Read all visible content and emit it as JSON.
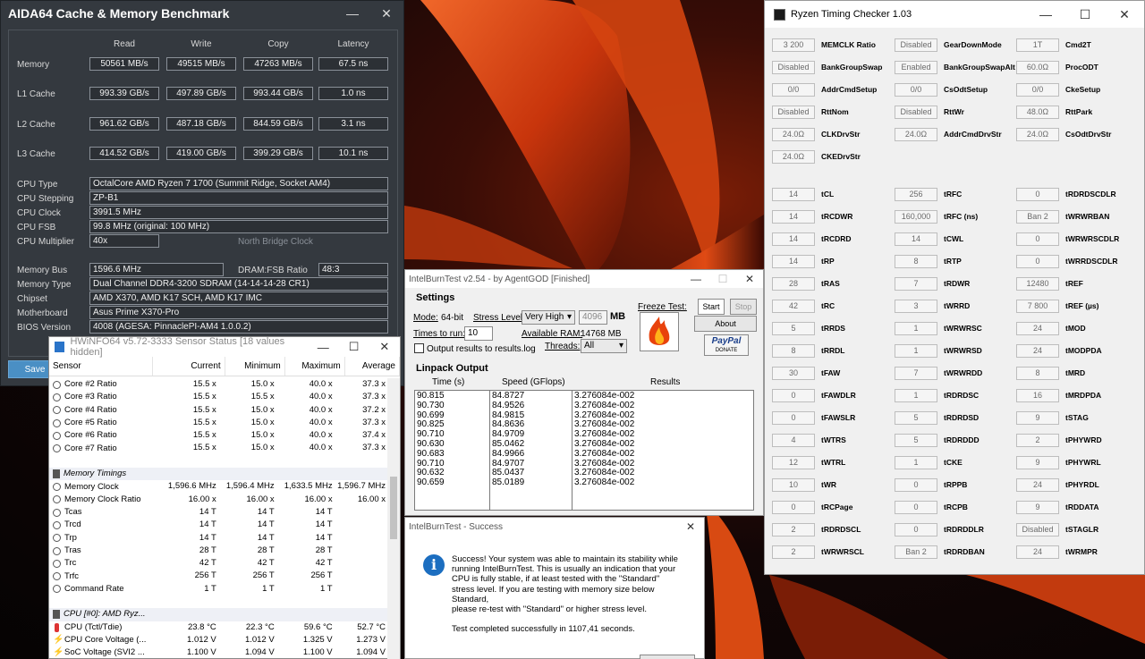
{
  "aida": {
    "title": "AIDA64 Cache & Memory Benchmark",
    "headers": [
      "Read",
      "Write",
      "Copy",
      "Latency"
    ],
    "rows": [
      {
        "label": "Memory",
        "read": "50561 MB/s",
        "write": "49515 MB/s",
        "copy": "47263 MB/s",
        "latency": "67.5 ns"
      },
      {
        "label": "L1 Cache",
        "read": "993.39 GB/s",
        "write": "497.89 GB/s",
        "copy": "993.44 GB/s",
        "latency": "1.0 ns"
      },
      {
        "label": "L2 Cache",
        "read": "961.62 GB/s",
        "write": "487.18 GB/s",
        "copy": "844.59 GB/s",
        "latency": "3.1 ns"
      },
      {
        "label": "L3 Cache",
        "read": "414.52 GB/s",
        "write": "419.00 GB/s",
        "copy": "399.29 GB/s",
        "latency": "10.1 ns"
      }
    ],
    "cpu_type_label": "CPU Type",
    "cpu_type": "OctalCore AMD Ryzen 7 1700  (Summit Ridge, Socket AM4)",
    "cpu_stepping_label": "CPU Stepping",
    "cpu_stepping": "ZP-B1",
    "cpu_clock_label": "CPU Clock",
    "cpu_clock": "3991.5 MHz",
    "cpu_fsb_label": "CPU FSB",
    "cpu_fsb": "99.8 MHz  (original: 100 MHz)",
    "cpu_mult_label": "CPU Multiplier",
    "cpu_mult": "40x",
    "nb_clock_label": "North Bridge Clock",
    "mem_bus_label": "Memory Bus",
    "mem_bus": "1596.6 MHz",
    "dram_fsb_label": "DRAM:FSB Ratio",
    "dram_fsb": "48:3",
    "mem_type_label": "Memory Type",
    "mem_type": "Dual Channel DDR4-3200 SDRAM  (14-14-14-28 CR1)",
    "chipset_label": "Chipset",
    "chipset": "AMD X370, AMD K17 SCH, AMD K17 IMC",
    "mobo_label": "Motherboard",
    "mobo": "Asus Prime X370-Pro",
    "bios_label": "BIOS Version",
    "bios": "4008  (AGESA: PinnaclePI-AM4 1.0.0.2)",
    "save": "Save"
  },
  "hwinfo": {
    "title": "HWiNFO64 v5.72-3333 Sensor Status [18 values hidden]",
    "headers": [
      "Sensor",
      "Current",
      "Minimum",
      "Maximum",
      "Average"
    ],
    "rows": [
      {
        "kind": "c",
        "name": "Core #2 Ratio",
        "cur": "15.5 x",
        "min": "15.0 x",
        "max": "40.0 x",
        "avg": "37.3 x"
      },
      {
        "kind": "c",
        "name": "Core #3 Ratio",
        "cur": "15.5 x",
        "min": "15.5 x",
        "max": "40.0 x",
        "avg": "37.3 x"
      },
      {
        "kind": "c",
        "name": "Core #4 Ratio",
        "cur": "15.5 x",
        "min": "15.0 x",
        "max": "40.0 x",
        "avg": "37.2 x"
      },
      {
        "kind": "c",
        "name": "Core #5 Ratio",
        "cur": "15.5 x",
        "min": "15.0 x",
        "max": "40.0 x",
        "avg": "37.3 x"
      },
      {
        "kind": "c",
        "name": "Core #6 Ratio",
        "cur": "15.5 x",
        "min": "15.0 x",
        "max": "40.0 x",
        "avg": "37.4 x"
      },
      {
        "kind": "c",
        "name": "Core #7 Ratio",
        "cur": "15.5 x",
        "min": "15.0 x",
        "max": "40.0 x",
        "avg": "37.3 x"
      },
      {
        "kind": "blank",
        "name": "",
        "cur": "",
        "min": "",
        "max": "",
        "avg": ""
      },
      {
        "kind": "grp",
        "name": "Memory Timings",
        "cur": "",
        "min": "",
        "max": "",
        "avg": ""
      },
      {
        "kind": "c",
        "name": "Memory Clock",
        "cur": "1,596.6 MHz",
        "min": "1,596.4 MHz",
        "max": "1,633.5 MHz",
        "avg": "1,596.7 MHz"
      },
      {
        "kind": "c",
        "name": "Memory Clock Ratio",
        "cur": "16.00 x",
        "min": "16.00 x",
        "max": "16.00 x",
        "avg": "16.00 x"
      },
      {
        "kind": "c",
        "name": "Tcas",
        "cur": "14 T",
        "min": "14 T",
        "max": "14 T",
        "avg": ""
      },
      {
        "kind": "c",
        "name": "Trcd",
        "cur": "14 T",
        "min": "14 T",
        "max": "14 T",
        "avg": ""
      },
      {
        "kind": "c",
        "name": "Trp",
        "cur": "14 T",
        "min": "14 T",
        "max": "14 T",
        "avg": ""
      },
      {
        "kind": "c",
        "name": "Tras",
        "cur": "28 T",
        "min": "28 T",
        "max": "28 T",
        "avg": ""
      },
      {
        "kind": "c",
        "name": "Trc",
        "cur": "42 T",
        "min": "42 T",
        "max": "42 T",
        "avg": ""
      },
      {
        "kind": "c",
        "name": "Trfc",
        "cur": "256 T",
        "min": "256 T",
        "max": "256 T",
        "avg": ""
      },
      {
        "kind": "c",
        "name": "Command Rate",
        "cur": "1 T",
        "min": "1 T",
        "max": "1 T",
        "avg": ""
      },
      {
        "kind": "blank",
        "name": "",
        "cur": "",
        "min": "",
        "max": "",
        "avg": ""
      },
      {
        "kind": "grp",
        "name": "CPU [#0]: AMD Ryz...",
        "cur": "",
        "min": "",
        "max": "",
        "avg": ""
      },
      {
        "kind": "t",
        "name": "CPU (Tctl/Tdie)",
        "cur": "23.8 °C",
        "min": "22.3 °C",
        "max": "59.6 °C",
        "avg": "52.7 °C"
      },
      {
        "kind": "v",
        "name": "CPU Core Voltage (...",
        "cur": "1.012 V",
        "min": "1.012 V",
        "max": "1.325 V",
        "avg": "1.273 V"
      },
      {
        "kind": "v",
        "name": "SoC Voltage (SVI2 ...",
        "cur": "1.100 V",
        "min": "1.094 V",
        "max": "1.100 V",
        "avg": "1.094 V"
      }
    ]
  },
  "ibt": {
    "title": "IntelBurnTest v2.54 - by AgentGOD [Finished]",
    "settings": "Settings",
    "mode_label": "Mode:",
    "mode": "64-bit",
    "stress_label": "Stress Level:",
    "stress": "Very High",
    "mem": "4096",
    "mb": "MB",
    "times_label": "Times to run:",
    "times": "10",
    "avail_label": "Available RAM:",
    "avail": "14768 MB",
    "output_cb": "Output results to results.log",
    "threads_label": "Threads:",
    "threads": "All",
    "freeze": "Freeze Test:",
    "start": "Start",
    "stop": "Stop",
    "about": "About",
    "paypal": "PayPal",
    "donate": "DONATE",
    "linpack": "Linpack Output",
    "col_time": "Time (s)",
    "col_speed": "Speed (GFlops)",
    "col_results": "Results",
    "times_list": [
      "90.815",
      "90.730",
      "90.699",
      "90.825",
      "90.710",
      "90.630",
      "90.683",
      "90.710",
      "90.632",
      "90.659"
    ],
    "speeds": [
      "84.8727",
      "84.9526",
      "84.9815",
      "84.8636",
      "84.9709",
      "85.0462",
      "84.9966",
      "84.9707",
      "85.0437",
      "85.0189"
    ],
    "results": [
      "3.276084e-002",
      "3.276084e-002",
      "3.276084e-002",
      "3.276084e-002",
      "3.276084e-002",
      "3.276084e-002",
      "3.276084e-002",
      "3.276084e-002",
      "3.276084e-002",
      "3.276084e-002"
    ]
  },
  "success": {
    "title": "IntelBurnTest - Success",
    "lines": [
      "Success! Your system was able to maintain its stability while",
      "running IntelBurnTest. This is usually an indication that your",
      "CPU is fully stable, if at least tested with the \"Standard\"",
      "stress level. If you are testing with memory size below",
      "Standard,",
      "please re-test with \"Standard\" or higher stress level.",
      "",
      "Test completed successfully in 1107,41 seconds."
    ]
  },
  "rtc": {
    "title": "Ryzen Timing Checker 1.03",
    "rows": [
      [
        [
          "3 200",
          "MEMCLK Ratio"
        ],
        [
          "Disabled",
          "GearDownMode"
        ],
        [
          "1T",
          "Cmd2T"
        ]
      ],
      [
        [
          "Disabled",
          "BankGroupSwap"
        ],
        [
          "Enabled",
          "BankGroupSwapAlt"
        ],
        [
          "60.0Ω",
          "ProcODT"
        ]
      ],
      [
        [
          "0/0",
          "AddrCmdSetup"
        ],
        [
          "0/0",
          "CsOdtSetup"
        ],
        [
          "0/0",
          "CkeSetup"
        ]
      ],
      [
        [
          "Disabled",
          "RttNom"
        ],
        [
          "Disabled",
          "RttWr"
        ],
        [
          "48.0Ω",
          "RttPark"
        ]
      ],
      [
        [
          "24.0Ω",
          "CLKDrvStr"
        ],
        [
          "24.0Ω",
          "AddrCmdDrvStr"
        ],
        [
          "24.0Ω",
          "CsOdtDrvStr"
        ]
      ],
      [
        [
          "24.0Ω",
          "CKEDrvStr"
        ]
      ],
      [],
      [
        [
          "14",
          "tCL"
        ],
        [
          "256",
          "tRFC"
        ],
        [
          "0",
          "tRDRDSCDLR"
        ]
      ],
      [
        [
          "14",
          "tRCDWR"
        ],
        [
          "160,000",
          "tRFC (ns)"
        ],
        [
          "Ban 2",
          "tWRWRBAN"
        ]
      ],
      [
        [
          "14",
          "tRCDRD"
        ],
        [
          "14",
          "tCWL"
        ],
        [
          "0",
          "tWRWRSCDLR"
        ]
      ],
      [
        [
          "14",
          "tRP"
        ],
        [
          "8",
          "tRTP"
        ],
        [
          "0",
          "tWRRDSCDLR"
        ]
      ],
      [
        [
          "28",
          "tRAS"
        ],
        [
          "7",
          "tRDWR"
        ],
        [
          "12480",
          "tREF"
        ]
      ],
      [
        [
          "42",
          "tRC"
        ],
        [
          "3",
          "tWRRD"
        ],
        [
          "7 800",
          "tREF (µs)"
        ]
      ],
      [
        [
          "5",
          "tRRDS"
        ],
        [
          "1",
          "tWRWRSC"
        ],
        [
          "24",
          "tMOD"
        ]
      ],
      [
        [
          "8",
          "tRRDL"
        ],
        [
          "1",
          "tWRWRSD"
        ],
        [
          "24",
          "tMODPDA"
        ]
      ],
      [
        [
          "30",
          "tFAW"
        ],
        [
          "7",
          "tWRWRDD"
        ],
        [
          "8",
          "tMRD"
        ]
      ],
      [
        [
          "0",
          "tFAWDLR"
        ],
        [
          "1",
          "tRDRDSC"
        ],
        [
          "16",
          "tMRDPDA"
        ]
      ],
      [
        [
          "0",
          "tFAWSLR"
        ],
        [
          "5",
          "tRDRDSD"
        ],
        [
          "9",
          "tSTAG"
        ]
      ],
      [
        [
          "4",
          "tWTRS"
        ],
        [
          "5",
          "tRDRDDD"
        ],
        [
          "2",
          "tPHYWRD"
        ]
      ],
      [
        [
          "12",
          "tWTRL"
        ],
        [
          "1",
          "tCKE"
        ],
        [
          "9",
          "tPHYWRL"
        ]
      ],
      [
        [
          "10",
          "tWR"
        ],
        [
          "0",
          "tRPPB"
        ],
        [
          "24",
          "tPHYRDL"
        ]
      ],
      [
        [
          "0",
          "tRCPage"
        ],
        [
          "0",
          "tRCPB"
        ],
        [
          "9",
          "tRDDATA"
        ]
      ],
      [
        [
          "2",
          "tRDRDSCL"
        ],
        [
          "0",
          "tRDRDDLR"
        ],
        [
          "Disabled",
          "tSTAGLR"
        ]
      ],
      [
        [
          "2",
          "tWRWRSCL"
        ],
        [
          "Ban 2",
          "tRDRDBAN"
        ],
        [
          "24",
          "tWRMPR"
        ]
      ]
    ]
  },
  "colors": {
    "aida_bg": "#34393f",
    "accent": "#4a8fc4",
    "info_blue": "#1c6ec0",
    "wallpaper_orange": "#e2490f"
  }
}
